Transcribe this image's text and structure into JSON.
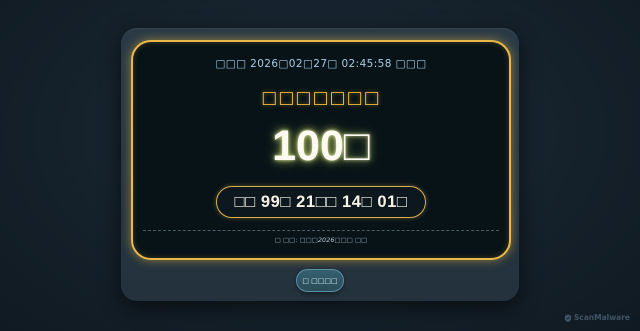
{
  "panel": {
    "date_line": "□□□ 2026□02□27□ 02:45:58 □□□",
    "heading": "□□□□□□□",
    "big_number": "100□",
    "countdown": "□□ 99□ 21□□ 14□ 01□",
    "footnote_prefix": "□ □□: □□□",
    "footnote_emphasis": "2026",
    "footnote_suffix": "□□□ □□"
  },
  "button": {
    "label": "□ □□□□"
  },
  "watermark": {
    "text": "ScanMalware"
  },
  "colors": {
    "accent": "#e9b84a",
    "heading": "#f2b940",
    "panel_bg": "#071317",
    "frame_bg": "#2a3a46"
  }
}
